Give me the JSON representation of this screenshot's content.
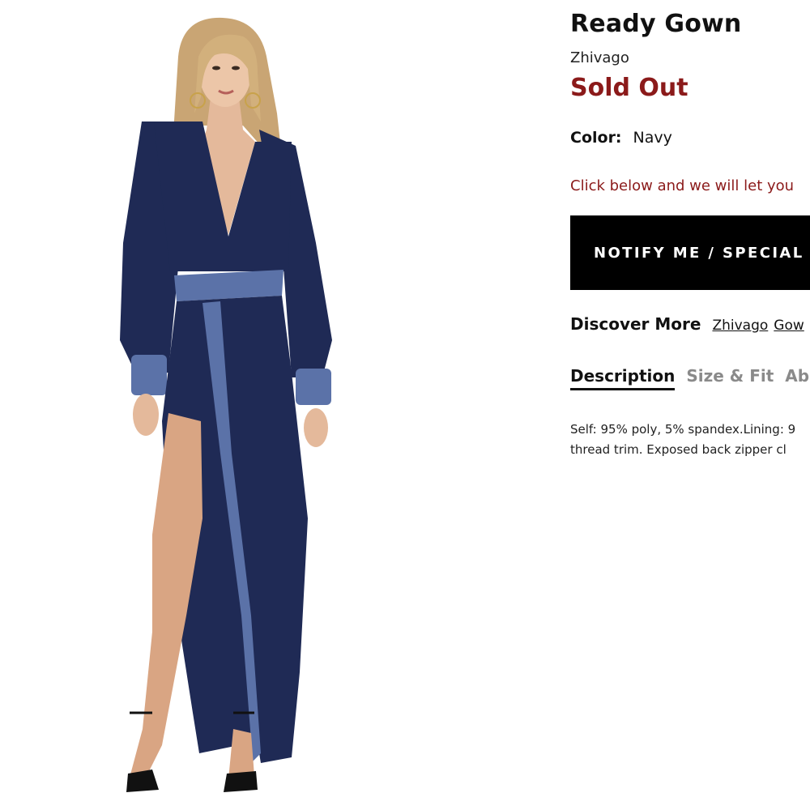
{
  "product": {
    "title": "Ready Gown",
    "brand": "Zhivago",
    "status": "Sold Out",
    "color_label": "Color:",
    "color_value": "Navy",
    "notice": "Click below and we will let you",
    "notify_button": "NOTIFY ME / SPECIAL",
    "discover_label": "Discover More",
    "discover_links": [
      "Zhivago",
      "Gow"
    ],
    "tabs": [
      "Description",
      "Size & Fit",
      "Ab"
    ],
    "active_tab": "Description",
    "description_lines": [
      "Self: 95% poly, 5% spandex.Lining: 9",
      "thread trim. Exposed back zipper cl"
    ]
  },
  "colors": {
    "status_red": "#8b1a1a",
    "button_bg": "#000000",
    "dress_navy": "#1f2a55",
    "trim_blue": "#5b72a8"
  },
  "icons": {
    "product_image": "model-in-navy-gown"
  }
}
